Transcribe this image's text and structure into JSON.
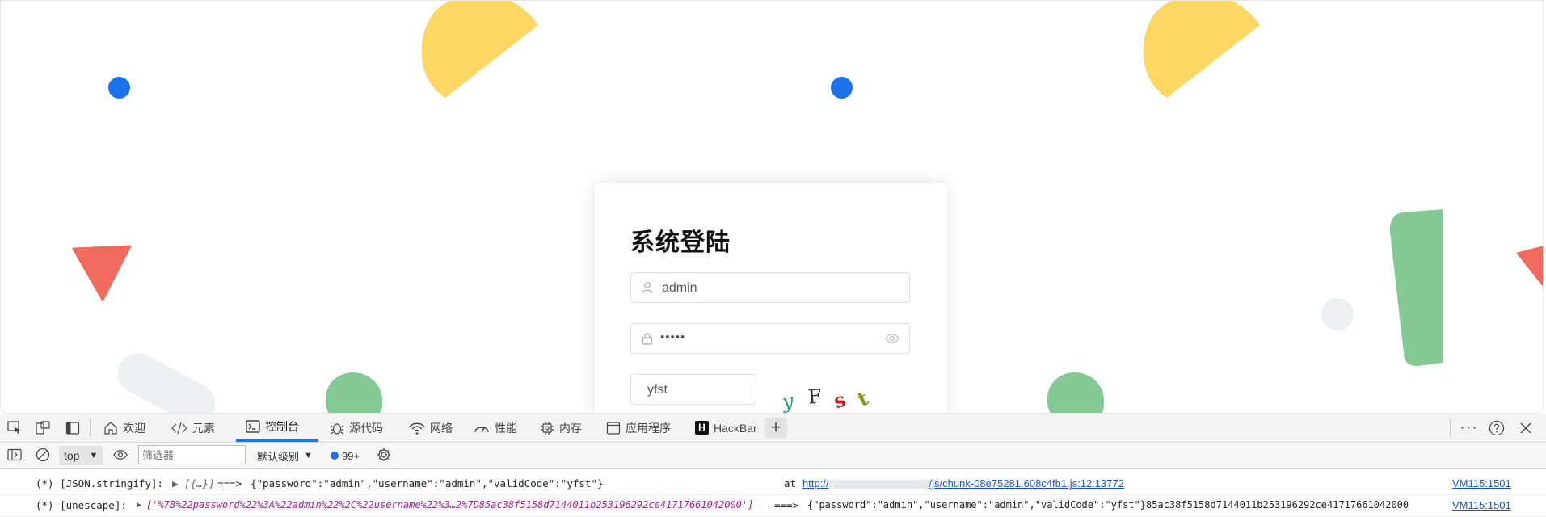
{
  "login": {
    "title": "系统登陆",
    "username_value": "admin",
    "password_value": "•••••",
    "captcha_input_value": "yfst",
    "captcha_chars": [
      "y",
      "F",
      "s",
      "t"
    ],
    "captcha_colors": [
      "#1aa66b",
      "#333333",
      "#c81818",
      "#7f9a10"
    ]
  },
  "colors": {
    "yellow": "#fdd664",
    "blue": "#1a73e8",
    "red": "#f06a5e",
    "green": "#84c993",
    "light_gray": "#eeeff1",
    "devtools_accent": "#1a73e8"
  },
  "devtools": {
    "tabs": [
      {
        "label": "欢迎",
        "icon": "home-icon"
      },
      {
        "label": "元素",
        "icon": "code-icon"
      },
      {
        "label": "控制台",
        "icon": "console-icon"
      },
      {
        "label": "源代码",
        "icon": "bug-icon"
      },
      {
        "label": "网络",
        "icon": "wifi-icon"
      },
      {
        "label": "性能",
        "icon": "gauge-icon"
      },
      {
        "label": "内存",
        "icon": "chip-icon"
      },
      {
        "label": "应用程序",
        "icon": "app-icon"
      },
      {
        "label": "HackBar",
        "icon": "hackbar-icon"
      }
    ],
    "add_tab": "+",
    "toolbar": {
      "context": "top",
      "filter_placeholder": "筛选器",
      "level": "默认级别",
      "issues_count": "99+"
    },
    "console": [
      {
        "prefix": "(*) [JSON.stringify]:",
        "collapsed": "▶ [{…}]",
        "arrow": "===>",
        "value": "{\"password\":\"admin\",\"username\":\"admin\",\"validCode\":\"yfst\"}",
        "at_label": "at",
        "at_link_start": "http://",
        "at_link_end": "/js/chunk-08e75281.608c4fb1.js:12:13772",
        "source": "VM115:1501"
      },
      {
        "prefix": "(*) [unescape]:",
        "collapsed": "▶",
        "array_value": "['%7B%22password%22%3A%22admin%22%2C%22username%22%3…2%7D85ac38f5158d7144011b253196292ce41717661042000']",
        "arrow": "===>",
        "value": "{\"password\":\"admin\",\"username\":\"admin\",\"validCode\":\"yfst\"}85ac38f5158d7144011b253196292ce41717661042000",
        "source": "VM115:1501"
      }
    ]
  }
}
